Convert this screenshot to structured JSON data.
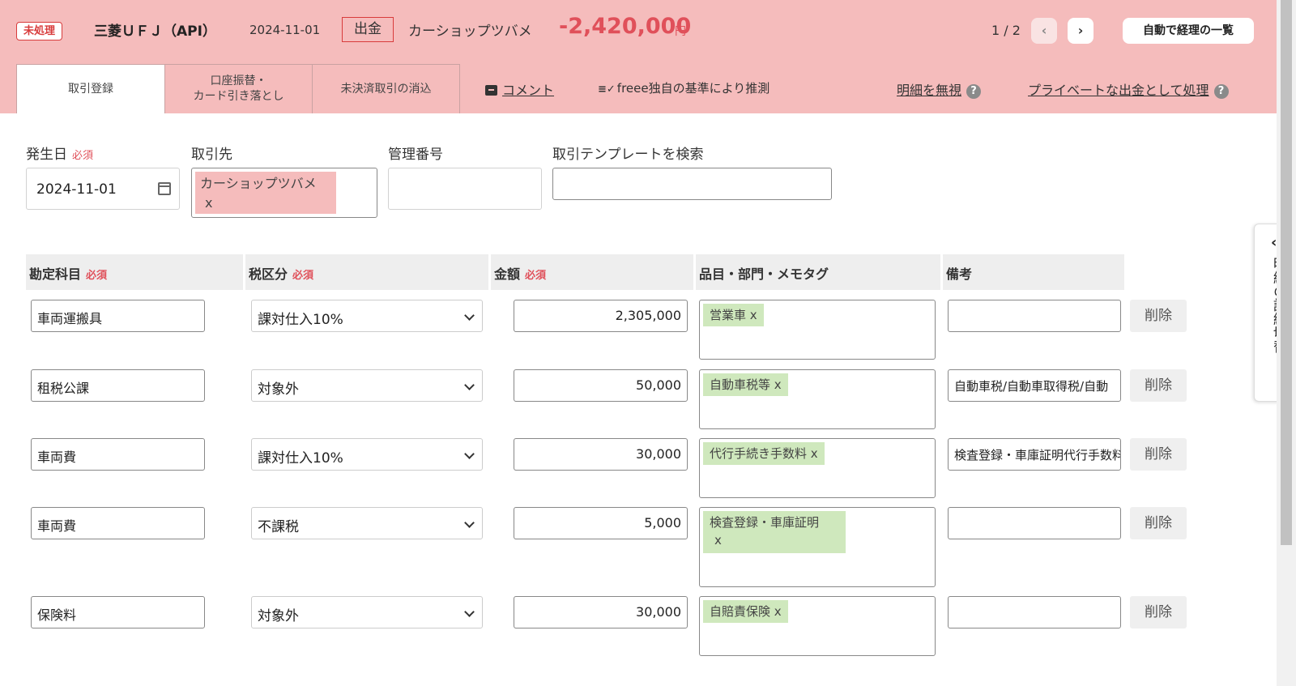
{
  "header": {
    "status_badge": "未処理",
    "bank": "三菱ＵＦＪ（API）",
    "date": "2024-11-01",
    "direction": "出金",
    "payee": "カーショップツバメ",
    "amount": "-2,420,000",
    "currency": "円",
    "pager": "1 / 2",
    "prev_icon": "‹",
    "next_icon": "›",
    "list_button": "自動で経理の一覧"
  },
  "tabs": [
    {
      "label": "取引登録"
    },
    {
      "label_line1": "口座振替・",
      "label_line2": "カード引き落とし"
    },
    {
      "label": "未決済取引の消込"
    }
  ],
  "links": {
    "comment": "コメント",
    "guess": "freee独自の基準により推測",
    "ignore": "明細を無視",
    "private": "プライベートな出金として処理",
    "help": "?"
  },
  "form": {
    "date_label": "発生日",
    "required": "必須",
    "date_value": "2024-11-01",
    "payee_label": "取引先",
    "payee_tag": "カーショップツバメ",
    "tag_remove": "x",
    "mgmt_label": "管理番号",
    "template_label": "取引テンプレートを検索"
  },
  "table": {
    "headers": [
      "勘定科目",
      "税区分",
      "金額",
      "品目・部門・メモタグ",
      "備考"
    ],
    "delete_label": "削除",
    "rows": [
      {
        "account": "車両運搬具",
        "tax": "課対仕入10%",
        "amount": "2,305,000",
        "tag": "営業車",
        "memo": ""
      },
      {
        "account": "租税公課",
        "tax": "対象外",
        "amount": "50,000",
        "tag": "自動車税等",
        "memo": "自動車税/自動車取得税/自動"
      },
      {
        "account": "車両費",
        "tax": "課対仕入10%",
        "amount": "30,000",
        "tag": "代行手続き手数料",
        "memo": "検査登録・車庫証明代行手数料"
      },
      {
        "account": "車両費",
        "tax": "不課税",
        "amount": "5,000",
        "tag": "検査登録・車庫証明",
        "memo": ""
      },
      {
        "account": "保険料",
        "tax": "対象外",
        "amount": "30,000",
        "tag": "自賠責保険",
        "memo": ""
      }
    ]
  },
  "side_panel": {
    "arrow": "‹",
    "label": "明細の詳細切替"
  },
  "colors": {
    "header_bg": "#f5bcbc",
    "accent_red": "#e0505a",
    "tag_green": "#cfe8bd"
  }
}
